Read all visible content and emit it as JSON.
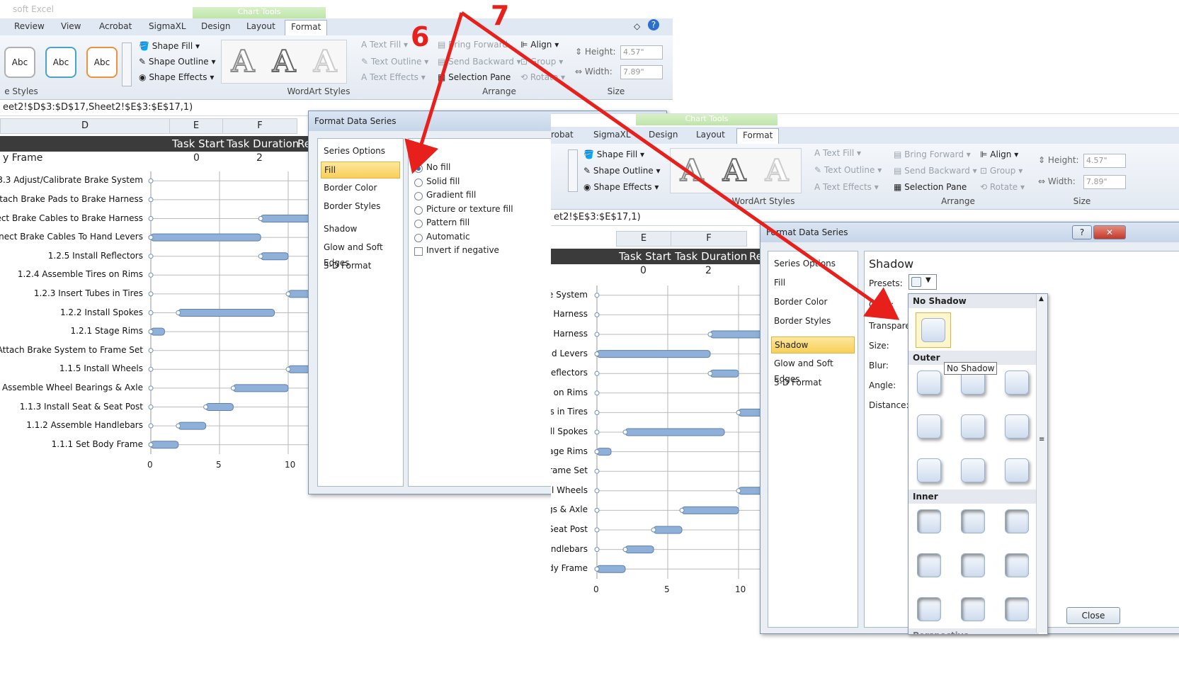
{
  "left": {
    "title_fragment": "soft Excel",
    "tabs": [
      "Review",
      "View",
      "Acrobat",
      "SigmaXL",
      "Design",
      "Layout",
      "Format"
    ],
    "context_tab": "Chart Tools",
    "shape_style_sample": "Abc",
    "shape_fill": "Shape Fill",
    "shape_outline": "Shape Outline",
    "shape_effects": "Shape Effects",
    "wordart_letter": "A",
    "text_fill": "Text Fill",
    "text_outline": "Text Outline",
    "text_effects": "Text Effects",
    "bring_forward": "Bring Forward",
    "send_backward": "Send Backward",
    "selection_pane": "Selection Pane",
    "align": "Align",
    "group": "Group",
    "rotate": "Rotate",
    "height_label": "Height:",
    "height_value": "4.57\"",
    "width_label": "Width:",
    "width_value": "7.89\"",
    "group_shape_styles": "e Styles",
    "group_wordart": "WordArt Styles",
    "group_arrange": "Arrange",
    "group_size": "Size",
    "formula": "eet2!$D$3:$D$17,Sheet2!$E$3:$E$17,1)",
    "col_d": "D",
    "col_e": "E",
    "col_f": "F",
    "hdr_task_start": "Task Start",
    "hdr_task_duration": "Task Duration",
    "hdr_r": "Re",
    "row_label": "y Frame",
    "row_e": "0",
    "row_f": "2",
    "task_labels": [
      "3.3 Adjust/Calibrate Brake System",
      "ttach Brake Pads to Brake Harness",
      "ect Brake Cables to Brake Harness",
      "nect Brake Cables To Hand Levers",
      "1.2.5 Install Reflectors",
      "1.2.4 Assemble Tires on Rims",
      "1.2.3 Insert Tubes in Tires",
      "1.2.2 Install Spokes",
      "1.2.1 Stage Rims",
      "Attach Brake System to Frame Set",
      "1.1.5 Install Wheels",
      "Assemble Wheel Bearings & Axle",
      "1.1.3 Install Seat & Seat Post",
      "1.1.2 Assemble Handlebars",
      "1.1.1 Set Body Frame"
    ],
    "axis_ticks": [
      "0",
      "5",
      "10"
    ]
  },
  "left_dialog": {
    "title": "Format Data Series",
    "help": "?",
    "close": "✕",
    "categories": [
      "Series Options",
      "Fill",
      "Border Color",
      "Border Styles",
      "Shadow",
      "Glow and Soft Edges",
      "3-D Format"
    ],
    "panel_title": "Fill",
    "options": [
      "No fill",
      "Solid fill",
      "Gradient fill",
      "Picture or texture fill",
      "Pattern fill",
      "Automatic"
    ],
    "invert": "Invert if negative"
  },
  "right": {
    "context_tab": "Chart Tools",
    "tabs": [
      "robat",
      "SigmaXL",
      "Design",
      "Layout",
      "Format"
    ],
    "shape_fill": "Shape Fill",
    "shape_outline": "Shape Outline",
    "shape_effects": "Shape Effects",
    "wordart_letter": "A",
    "text_fill": "Text Fill",
    "text_outline": "Text Outline",
    "text_effects": "Text Effects",
    "bring_forward": "Bring Forward",
    "send_backward": "Send Backward",
    "selection_pane": "Selection Pane",
    "align": "Align",
    "group": "Group",
    "rotate": "Rotate",
    "height_label": "Height:",
    "height_value": "4.57\"",
    "width_label": "Width:",
    "width_value": "7.89\"",
    "group_wordart": "WordArt Styles",
    "group_arrange": "Arrange",
    "group_size": "Size",
    "formula": "et2!$E$3:$E$17,1)",
    "col_e": "E",
    "col_f": "F",
    "hdr_task_start": "Task Start",
    "hdr_task_duration": "Task Duration",
    "hdr_r": "Re",
    "row_e": "0",
    "row_f": "2",
    "task_labels": [
      "e System",
      "e Harness",
      "e Harness",
      "nd Levers",
      "Reflectors",
      "s on Rims",
      "es in Tires",
      "all Spokes",
      "age Rims",
      "rame Set",
      "ll Wheels",
      "ngs & Axle",
      "Seat Post",
      "ndlebars",
      "dy Frame"
    ],
    "axis_ticks": [
      "0",
      "5",
      "10"
    ]
  },
  "right_dialog": {
    "title": "Format Data Series",
    "help": "?",
    "categories": [
      "Series Options",
      "Fill",
      "Border Color",
      "Border Styles",
      "Shadow",
      "Glow and Soft Edges",
      "3-D Format"
    ],
    "panel_title": "Shadow",
    "presets": "Presets:",
    "color": "Color:",
    "transparency": "Transparen",
    "size": "Size:",
    "blur": "Blur:",
    "angle": "Angle:",
    "distance": "Distance:",
    "no_shadow_header": "No Shadow",
    "outer_header": "Outer",
    "inner_header": "Inner",
    "perspective_header": "Perspective",
    "tooltip": "No Shadow",
    "close_button": "Close"
  },
  "annotations": {
    "six": "6",
    "seven": "7"
  },
  "colors": {
    "arrow": "#e8201c",
    "accent_tab": "#3b9a2a",
    "bar": "#8fb0d8",
    "selected": "#f8cf58"
  }
}
